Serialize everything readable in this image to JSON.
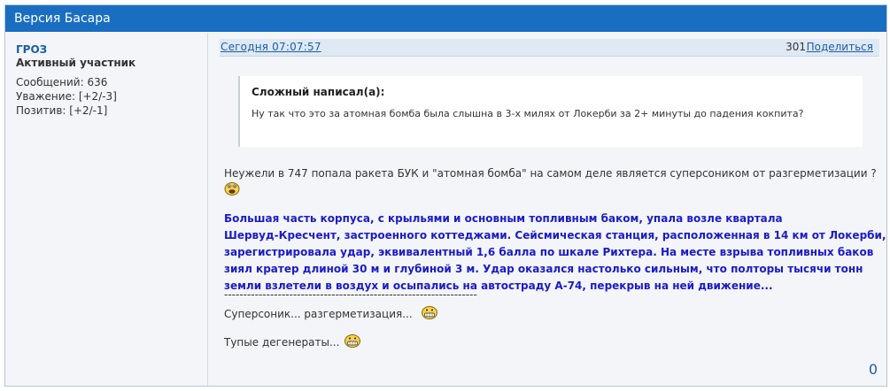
{
  "topic": {
    "title": "Версия Басара"
  },
  "author": {
    "name": "ГРОЗ",
    "rank": "Активный участник",
    "stats": [
      "Сообщений: 636",
      "Уважение: [+2/-3]",
      "Позитив: [+2/-1]"
    ]
  },
  "post": {
    "date": "Сегодня 07:07:57",
    "number": "301",
    "share_label": "Поделиться",
    "quote": {
      "author": "Сложный написал(а):",
      "text": "Ну так что это за атомная бомба была слышна в 3-х милях от Локерби за 2+ минуты до падения кокпита?"
    },
    "paragraph1": "Неужели в 747 попала ракета БУК  и  \"атомная бомба\" на самом деле является суперсоником от разгерметизации ?",
    "blue_lines": [
      "Большая часть корпуса, с крыльями и основным топливным баком, упала возле квартала",
      "Шервуд-Кресчент, застроенного коттеджами. Сейсмическая станция, расположенная в 14 км от Локерби,",
      "зарегистрировала удар, эквивалентный 1,6 балла по шкале Рихтера. На месте взрыва топливных баков",
      "зиял кратер длиной 30 м и глубиной 3 м. Удар оказался настолько сильным, что полторы тысячи тонн",
      "земли взлетели в воздух и осыпались на автостраду А-74, перекрыв на ней движение..."
    ],
    "divider": "------------------------------------------------------------------",
    "line2": "Суперсоник... разгерметизация...",
    "line3": "Тупые дегенераты...",
    "reputation": "0"
  },
  "colors": {
    "header_bg": "#1a6ec2",
    "link": "#1a5ea8",
    "blue_text": "#1b1bc8"
  },
  "icons": {
    "smiley_sad": "sad-face-icon",
    "smiley_grin": "grin-face-icon"
  }
}
